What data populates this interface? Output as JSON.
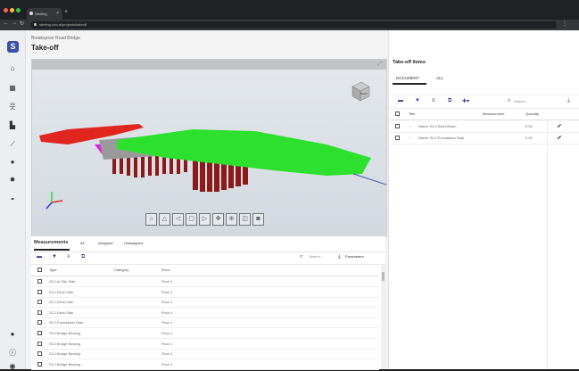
{
  "browser": {
    "tab_title": "Sterling",
    "tab_close": "×",
    "new_tab": "+",
    "url": "sterling-dco.ai/projects/takeoff"
  },
  "sidebar": {
    "logo_letter": "S",
    "icons": [
      "home-icon",
      "dashboard-icon",
      "person-icon",
      "building-icon",
      "chart-icon",
      "settings-icon",
      "gear-icon",
      "robot-icon"
    ],
    "bottom_icons": [
      "theme-icon",
      "info-icon",
      "user-icon"
    ]
  },
  "header": {
    "project": "Breakspear Road Bridge",
    "title": "Take-off"
  },
  "viewer": {
    "nav_cube_label": "BACK",
    "tool_icons": [
      "home-view-icon",
      "perspective-icon",
      "orbit-icon",
      "section-box-icon",
      "select-icon",
      "pan-icon",
      "zoom-icon",
      "model-browser-icon",
      "screenshot-icon"
    ]
  },
  "measurements": {
    "tabs": [
      "Measurements",
      "All",
      "Assigned",
      "Unassigned"
    ],
    "search_placeholder": "Search...",
    "parameters_label": "Parameters",
    "columns": [
      "Type",
      "Category",
      "Floor"
    ],
    "rows": [
      {
        "type": "SCJ-In Situ Slab",
        "category": "",
        "floor": "Floor 1"
      },
      {
        "type": "SCJ-Deck Slab",
        "category": "",
        "floor": "Floor 1"
      },
      {
        "type": "SCJ-Deck Slab",
        "category": "",
        "floor": "Floor 1"
      },
      {
        "type": "SCJ-Deck Slab",
        "category": "",
        "floor": "Floor 1"
      },
      {
        "type": "SCJ-Foundation Slab",
        "category": "",
        "floor": "Floor 1"
      },
      {
        "type": "SCJ-Bridge Bearing",
        "category": "",
        "floor": "Floor 1"
      },
      {
        "type": "SCJ-Bridge Bearing",
        "category": "",
        "floor": "Floor 1"
      },
      {
        "type": "SCJ-Bridge Bearing",
        "category": "",
        "floor": "Floor 1"
      },
      {
        "type": "SCJ-Bridge Bearing",
        "category": "",
        "floor": "Floor 1"
      }
    ]
  },
  "takeoff": {
    "title": "Take-off items",
    "tabs": [
      "DOCUMENT",
      "ALL"
    ],
    "search_placeholder": "Search...",
    "columns": [
      "Title",
      "Measurement",
      "Quantity"
    ],
    "rows": [
      {
        "title": "Name: SCJ-Steel Beam",
        "quantity": "0.00"
      },
      {
        "title": "Name: SCJ-Foundation Slab",
        "quantity": "0.00"
      }
    ]
  },
  "colors": {
    "accent": "#2a3a8a",
    "logo": "#3c4fa8",
    "model_green": "#2ee02e",
    "model_red": "#e0261f",
    "model_magenta": "#e020e0",
    "model_darkred": "#8b1a1a"
  }
}
